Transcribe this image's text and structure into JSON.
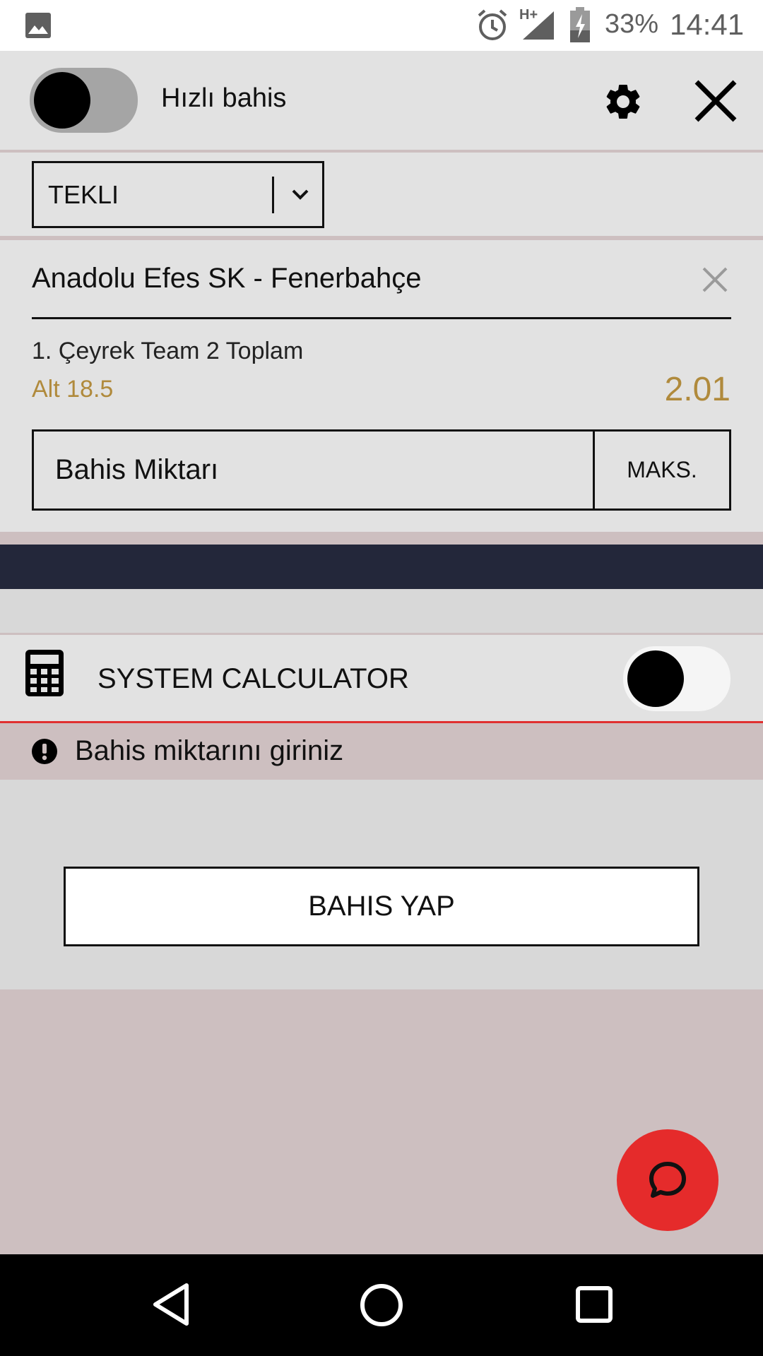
{
  "status_bar": {
    "battery_percent": "33%",
    "time": "14:41",
    "network_type": "H+",
    "icons": [
      "image-icon",
      "alarm-icon",
      "signal-icon",
      "battery-icon"
    ]
  },
  "header": {
    "quick_bet_label": "Hızlı bahis",
    "quick_bet_enabled": false,
    "settings_icon": "gear-icon",
    "close_icon": "close-icon"
  },
  "bet_type": {
    "selected": "TEKLI"
  },
  "bet": {
    "event": "Anadolu Efes SK - Fenerbahçe",
    "market": "1. Çeyrek Team 2 Toplam",
    "selection": "Alt 18.5",
    "odds": "2.01",
    "stake_placeholder": "Bahis Miktarı",
    "max_label": "MAKS."
  },
  "system_calculator": {
    "label": "SYSTEM CALCULATOR",
    "enabled": false
  },
  "warning": {
    "text": "Bahis miktarını giriniz"
  },
  "place_bet": {
    "label": "BAHIS YAP"
  },
  "chat": {
    "icon": "chat-icon"
  },
  "colors": {
    "accent_red": "#e52b2b",
    "odds_gold": "#b08a3c",
    "dark_band": "#23273a"
  }
}
